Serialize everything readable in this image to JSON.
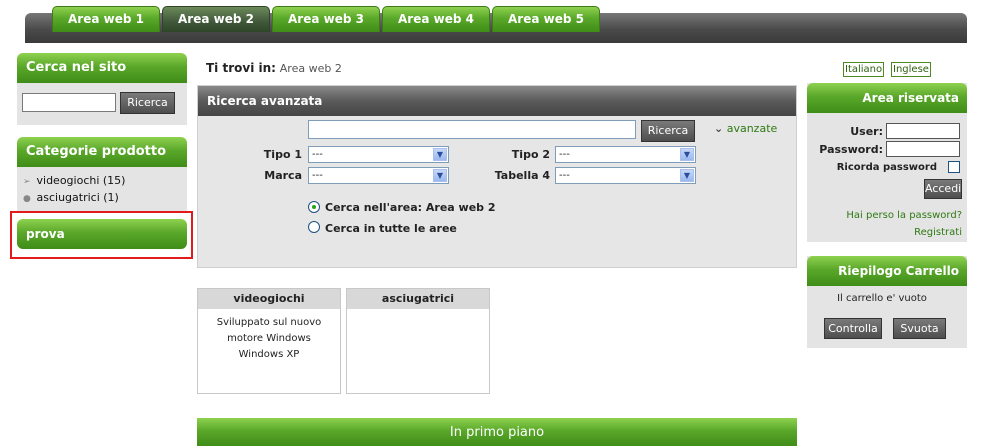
{
  "nav": {
    "tabs": [
      {
        "label": "Area web 1"
      },
      {
        "label": "Area web 2"
      },
      {
        "label": "Area web 3"
      },
      {
        "label": "Area web 4"
      },
      {
        "label": "Area web 5"
      }
    ],
    "active_tab": "Area web 2"
  },
  "sidebar": {
    "search": {
      "title": "Cerca nel sito",
      "value": "",
      "button": "Ricerca"
    },
    "categories": {
      "title": "Categorie prodotto",
      "items": [
        {
          "label": "videogiochi (15)",
          "icon": "arrow-right-icon"
        },
        {
          "label": "asciugatrici (1)",
          "icon": "bullet-icon"
        }
      ]
    },
    "prova": {
      "title": "prova"
    }
  },
  "breadcrumb": {
    "label": "Ti trovi in:",
    "value": "Area web 2"
  },
  "advanced_search": {
    "title": "Ricerca avanzata",
    "query": "",
    "button": "Ricerca",
    "toggle": "avanzate",
    "fields": {
      "tipo1": {
        "label": "Tipo 1",
        "value": "---"
      },
      "tipo2": {
        "label": "Tipo 2",
        "value": "---"
      },
      "marca": {
        "label": "Marca",
        "value": "---"
      },
      "tabella4": {
        "label": "Tabella 4",
        "value": "---"
      }
    },
    "scope": [
      {
        "label": "Cerca nell'area: Area web 2",
        "selected": true
      },
      {
        "label": "Cerca in tutte le aree",
        "selected": false
      }
    ]
  },
  "products": [
    {
      "title": "videogiochi",
      "description": "Sviluppato sul nuovo motore Windows Windows XP"
    },
    {
      "title": "asciugatrici",
      "description": ""
    }
  ],
  "featured": {
    "title": "In primo piano"
  },
  "languages": [
    {
      "label": "Italiano"
    },
    {
      "label": "Inglese"
    }
  ],
  "login": {
    "title": "Area riservata",
    "user_label": "User:",
    "password_label": "Password:",
    "remember_label": "Ricorda password",
    "button": "Accedi",
    "lost_password": "Hai perso la password?",
    "register": "Registrati"
  },
  "cart": {
    "title": "Riepilogo Carrello",
    "status": "Il carrello e' vuoto",
    "check_button": "Controlla",
    "empty_button": "Svuota"
  },
  "colors": {
    "accent_green": "#5aa82a",
    "dark_gray": "#4a4a4a",
    "highlight_red": "#e21a1a"
  }
}
